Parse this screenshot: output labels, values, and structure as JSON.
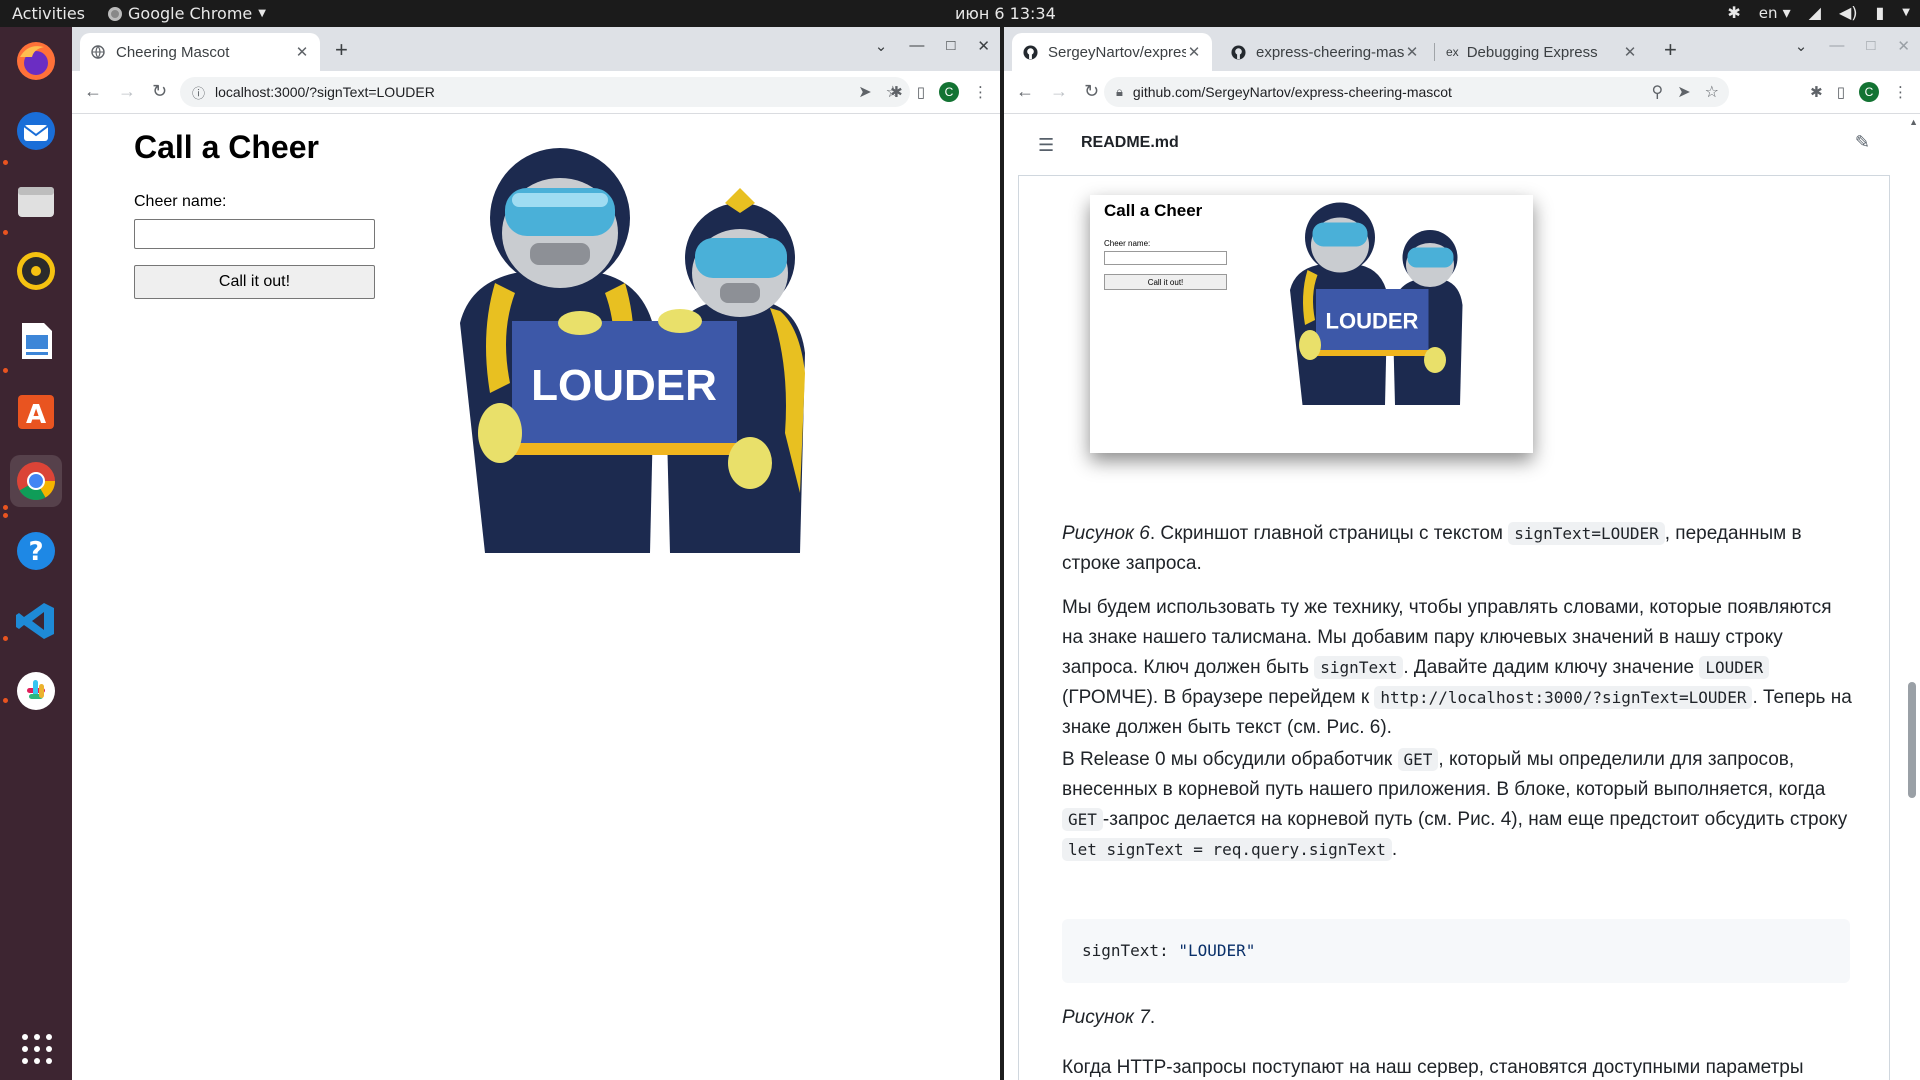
{
  "topbar": {
    "activities": "Activities",
    "app_name": "Google Chrome",
    "clock": "июн 6  13:34",
    "lang": "en"
  },
  "dock": {
    "icons": [
      "firefox-icon",
      "thunderbird-icon",
      "files-icon",
      "rhythmbox-icon",
      "writer-icon",
      "app-center-icon",
      "chrome-icon",
      "help-icon",
      "vscode-icon",
      "slack-icon",
      "show-apps-icon"
    ]
  },
  "left_window": {
    "tab_title": "Cheering Mascot",
    "url": "localhost:3000/?signText=LOUDER",
    "page": {
      "heading": "Call a Cheer",
      "field_label": "Cheer name:",
      "field_value": "",
      "button_label": "Call it out!",
      "sign_text": "LOUDER"
    }
  },
  "right_window": {
    "tabs": [
      {
        "title": "SergeyNartov/express-ch",
        "active": true
      },
      {
        "title": "express-cheering-masco",
        "active": false
      },
      {
        "title": "Debugging Express",
        "active": false
      }
    ],
    "tab3_favicon": "ex",
    "url": "github.com/SergeyNartov/express-cheering-mascot",
    "readme_name": "README.md",
    "screenshot": {
      "heading": "Call a Cheer",
      "label": "Cheer name:",
      "button": "Call it out!",
      "sign": "LOUDER"
    },
    "fig6": {
      "caption_em": "Рисунок 6",
      "text1": ". Скриншот главной страницы с текстом ",
      "code1": "signText=LOUDER",
      "text2": ", переданным в строке запроса."
    },
    "para1": {
      "t1": "Мы будем использовать ту же технику, чтобы управлять словами, которые появляются на знаке нашего талисмана. Мы добавим пару ключевых значений в нашу строку запроса. Ключ должен быть ",
      "c1": "signText",
      "t2": ". Давайте дадим ключу значение ",
      "c2": "LOUDER",
      "t3": " (ГРОМЧЕ). В браузере перейдем к ",
      "c3": "http://localhost:3000/?signText=LOUDER",
      "t4": ". Теперь на знаке должен быть текст (см. Рис. 6)."
    },
    "para2": {
      "t1": "В Release 0 мы обсудили обработчик ",
      "c1": "GET",
      "t2": ", который мы определили для запросов, внесенных в корневой путь нашего приложения. В блоке, который выполняется, когда ",
      "c2": "GET",
      "t3": "-запрос делается на корневой путь (см. Рис. 4), нам еще предстоит обсудить строку ",
      "c3": "let signText = req.query.signText",
      "t4": "."
    },
    "codeblock": {
      "key": "signText: ",
      "value": "\"LOUDER\""
    },
    "fig7": "Рисунок 7",
    "fig7_dot": ".",
    "para3": "Когда HTTP-запросы поступают на наш сервер, становятся доступными параметры строки запроса. Пары «ключ-значение» добавляются к req.query. В нашем примере,"
  }
}
